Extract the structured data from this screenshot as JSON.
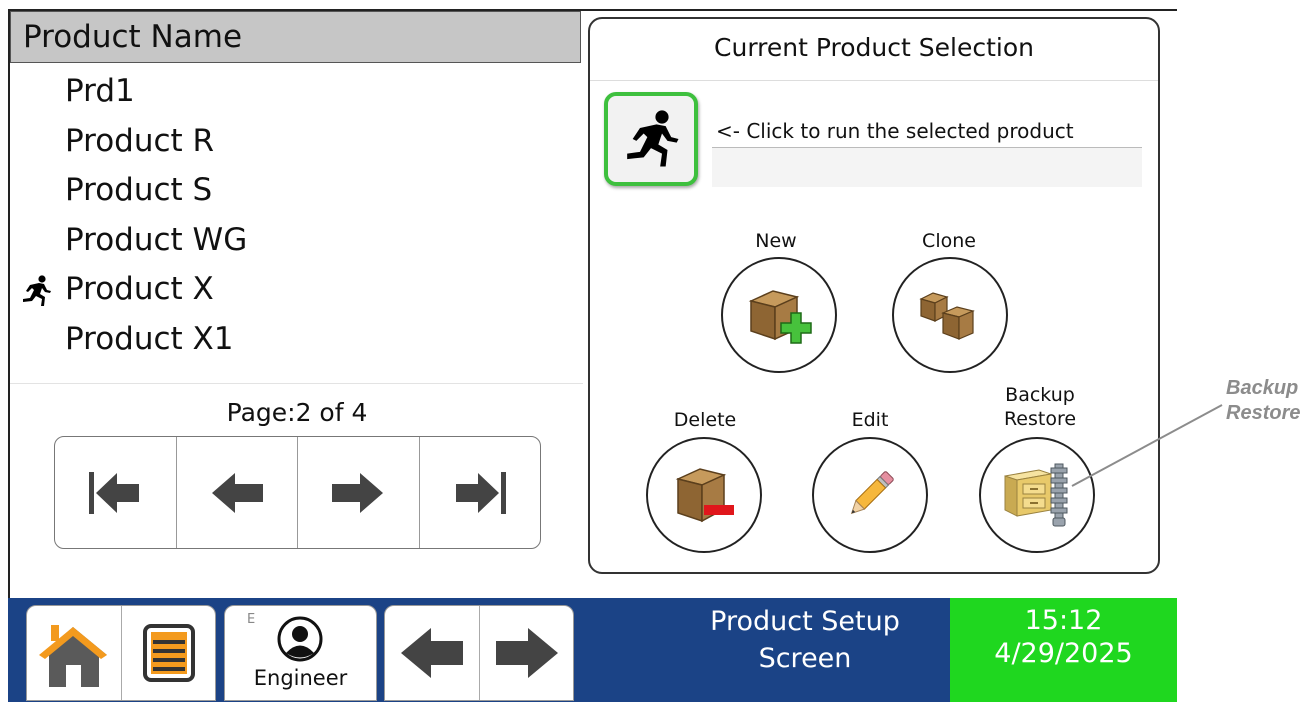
{
  "list": {
    "header": "Product Name",
    "items": [
      {
        "name": "Prd1",
        "running": false
      },
      {
        "name": "Product R",
        "running": false
      },
      {
        "name": "Product S",
        "running": false
      },
      {
        "name": "Product WG",
        "running": false
      },
      {
        "name": "Product X",
        "running": true
      },
      {
        "name": "Product X1",
        "running": false
      }
    ],
    "page_label": "Page:2 of 4"
  },
  "pager": {
    "icons": [
      "first-page-icon",
      "previous-page-icon",
      "next-page-icon",
      "last-page-icon"
    ]
  },
  "selection": {
    "title": "Current Product Selection",
    "run_hint": "<- Click to run the selected product",
    "run_product_value": "",
    "buttons": {
      "new": "New",
      "clone": "Clone",
      "delete": "Delete",
      "edit": "Edit",
      "backup_restore_line1": "Backup",
      "backup_restore_line2": "Restore"
    }
  },
  "bottom_bar": {
    "user_badge": "E",
    "user_label": "Engineer",
    "screen_title_line1": "Product Setup",
    "screen_title_line2": "Screen",
    "time": "15:12",
    "date": "4/29/2025"
  },
  "callout": {
    "line1": "Backup",
    "line2": "Restore"
  },
  "colors": {
    "bottom_bar": "#1b4386",
    "clock_bg": "#1fd71f",
    "run_button_border": "#3ec03e",
    "home_roof": "#f39a1e",
    "box": "#a77b44",
    "add_plus": "#47c23c",
    "remove_minus": "#e0161b"
  }
}
